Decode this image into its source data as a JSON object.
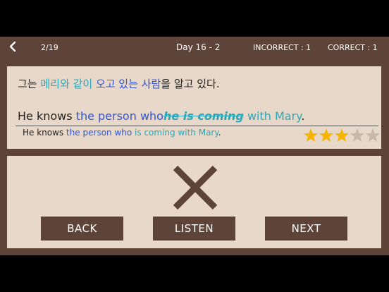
{
  "header": {
    "counter": "2/19",
    "day": "Day 16 - 2",
    "incorrect": "INCORRECT : 1",
    "correct": "CORRECT : 1"
  },
  "question": {
    "korean": {
      "prefix": "그는 ",
      "teal1": "메리와 같이",
      "space1": " ",
      "blue1": "오고 있는",
      "space2": " ",
      "blue2": "사람",
      "suffix": "을 알고 있다."
    },
    "user_answer": {
      "prefix": "He knows ",
      "blue": "the person who",
      "strike": "he is coming",
      "space": " ",
      "teal": "with Mary",
      "suffix": "."
    },
    "correct_answer": {
      "prefix": "He knows ",
      "blue": "the person who",
      "space": " ",
      "teal": "is coming with Mary",
      "suffix": "."
    }
  },
  "rating": {
    "stars_filled": 3,
    "stars_total": 5,
    "filled_color": "#f5b400",
    "empty_color": "#c8b8a8"
  },
  "result": {
    "icon": "x-mark-icon",
    "color": "#5e4438"
  },
  "buttons": {
    "back": "BACK",
    "listen": "LISTEN",
    "next": "NEXT"
  },
  "colors": {
    "teal": "#2ba7b8",
    "blue": "#2f55d9",
    "panel": "#e8d8c9",
    "frame": "#5e4438"
  }
}
